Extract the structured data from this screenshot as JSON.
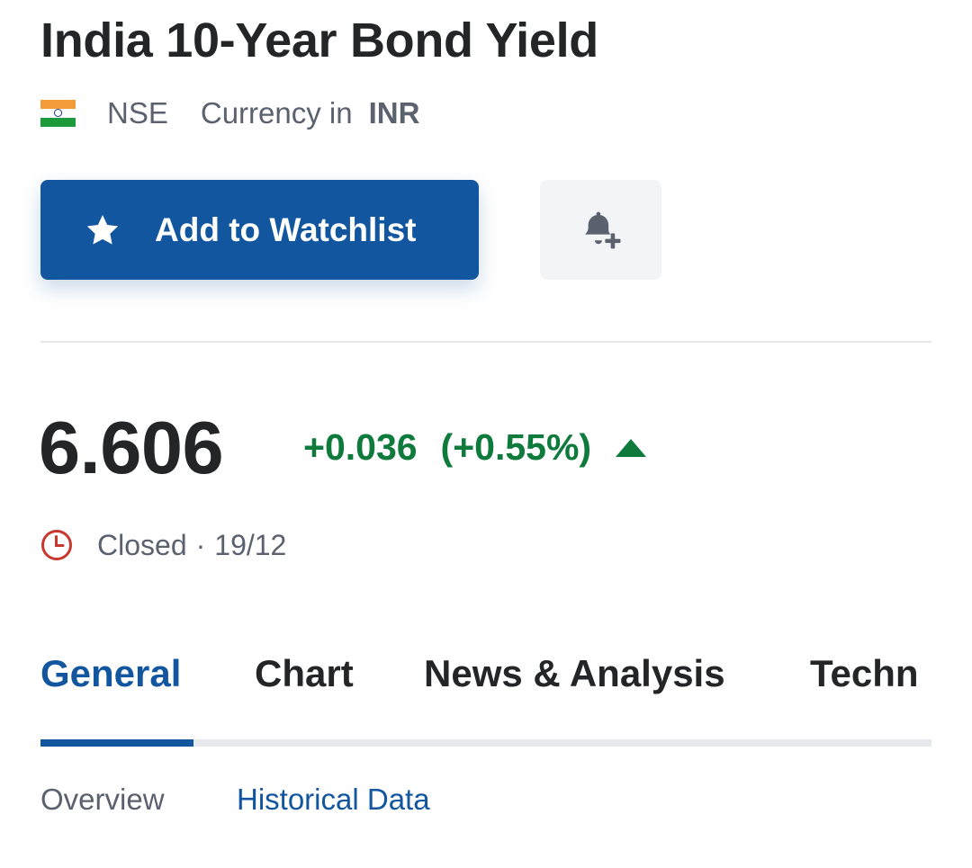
{
  "header": {
    "title": "India 10-Year Bond Yield",
    "flag_icon": "india-flag-icon",
    "exchange": "NSE",
    "currency_label": "Currency in",
    "currency_value": "INR"
  },
  "actions": {
    "watchlist_label": "Add to Watchlist",
    "watchlist_icon": "star-icon",
    "alert_icon": "bell-plus-icon"
  },
  "quote": {
    "price": "6.606",
    "change": "+0.036",
    "change_percent": "(+0.55%)",
    "direction_icon": "triangle-up-icon",
    "status": "Closed",
    "separator": "·",
    "date": "19/12"
  },
  "tabs": [
    {
      "label": "General",
      "active": true
    },
    {
      "label": "Chart",
      "active": false
    },
    {
      "label": "News & Analysis",
      "active": false
    },
    {
      "label": "Techn",
      "active": false
    }
  ],
  "subtabs": [
    {
      "label": "Overview",
      "active": false
    },
    {
      "label": "Historical Data",
      "active": true
    }
  ],
  "colors": {
    "brand_blue": "#1256a0",
    "positive_green": "#0e7a3c",
    "closed_red": "#c8382d"
  }
}
